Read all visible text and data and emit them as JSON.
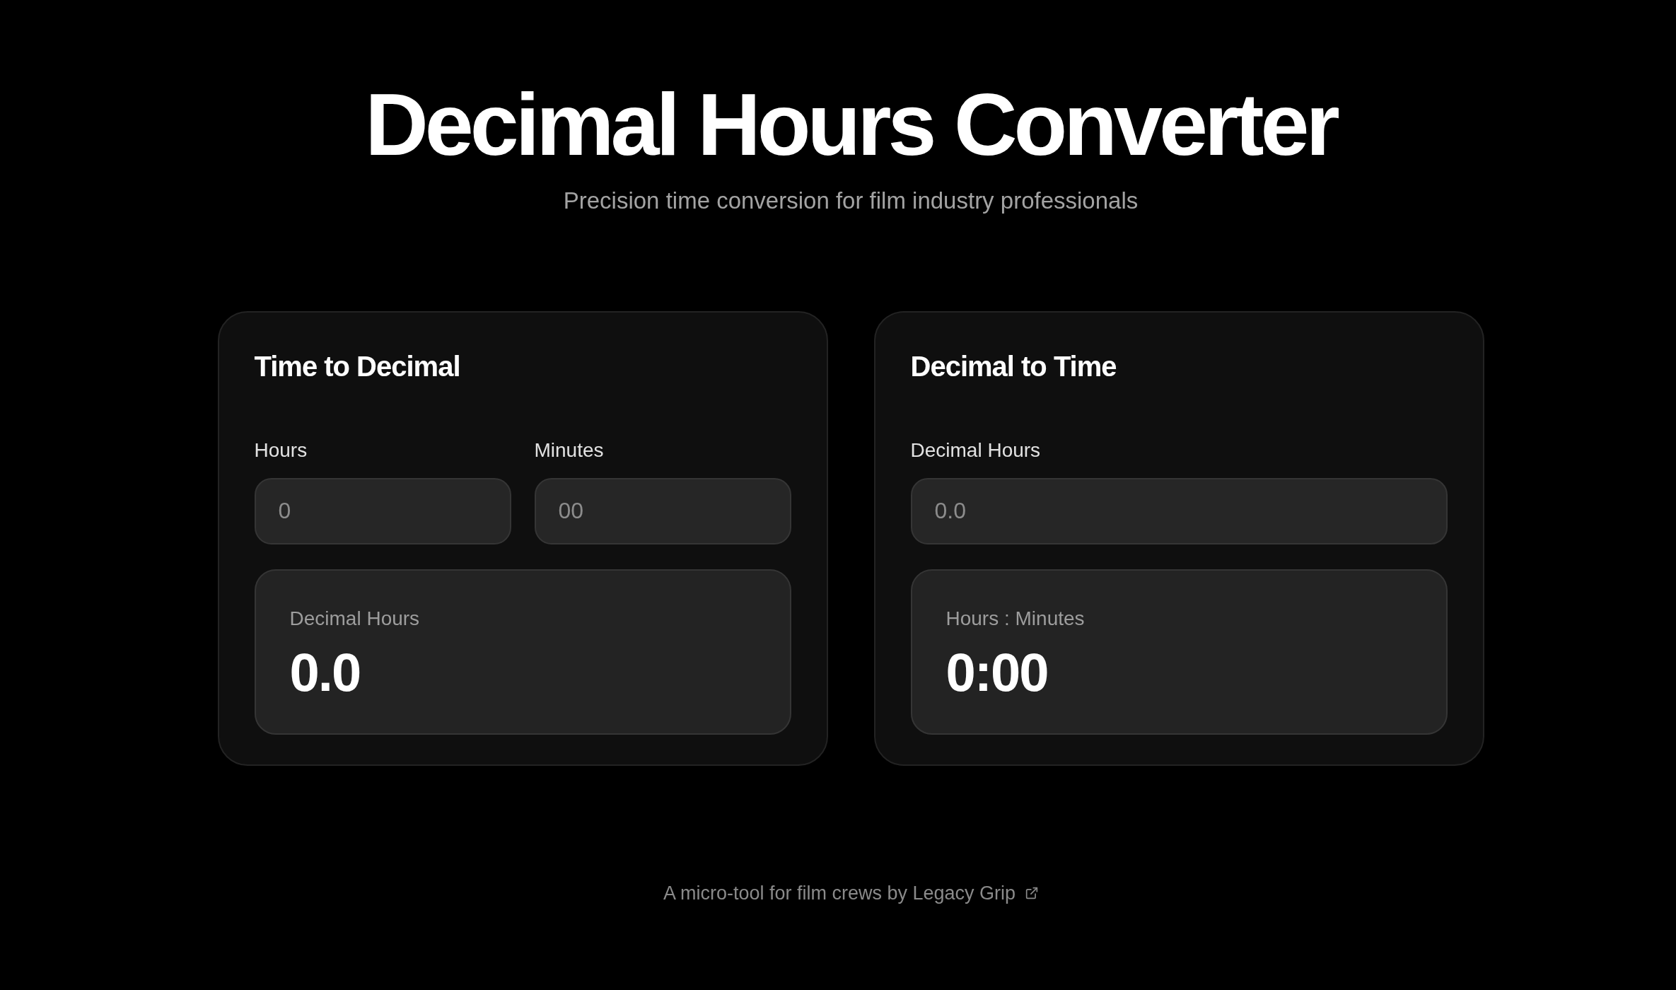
{
  "header": {
    "title": "Decimal Hours Converter",
    "subtitle": "Precision time conversion for film industry professionals"
  },
  "converters": [
    {
      "title": "Time to Decimal",
      "fields": [
        {
          "label": "Hours",
          "placeholder": "0"
        },
        {
          "label": "Minutes",
          "placeholder": "00"
        }
      ],
      "result": {
        "label": "Decimal Hours",
        "value": "0.0"
      }
    },
    {
      "title": "Decimal to Time",
      "fields": [
        {
          "label": "Decimal Hours",
          "placeholder": "0.0"
        }
      ],
      "result": {
        "label": "Hours : Minutes",
        "value": "0:00"
      }
    }
  ],
  "footer": {
    "text": "A micro-tool for film crews by",
    "link": "Legacy Grip"
  }
}
